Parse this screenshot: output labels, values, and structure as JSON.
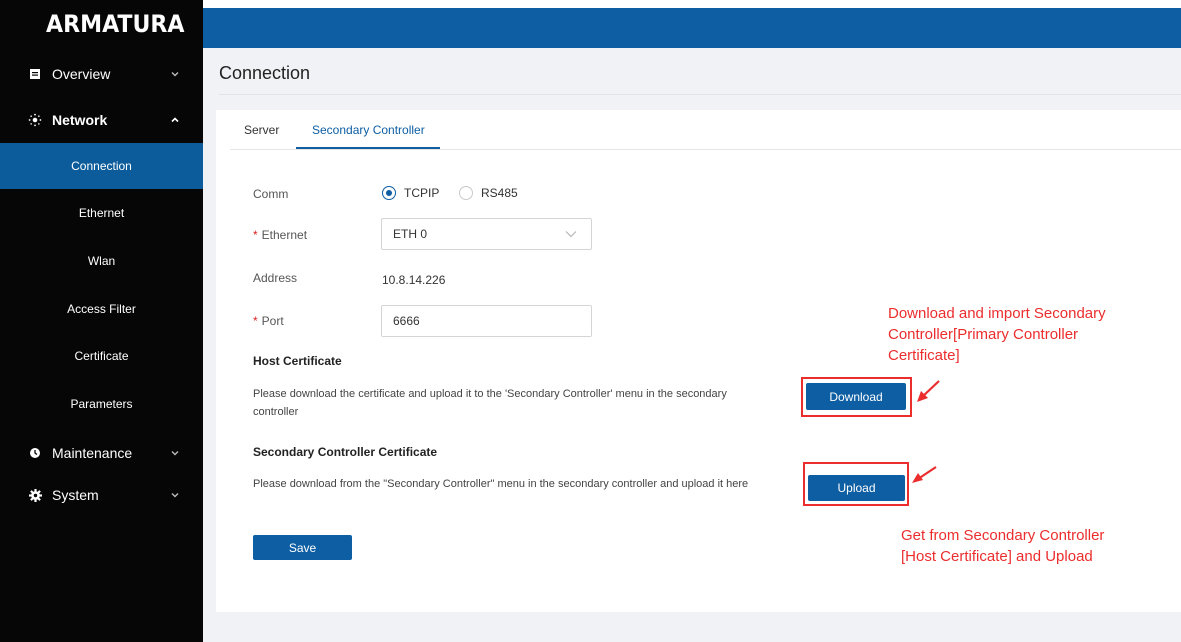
{
  "brand": {
    "logo_text": "ARMATURA"
  },
  "sidebar": {
    "groups": [
      {
        "label": "Overview",
        "icon": "overview-icon",
        "expanded": false
      },
      {
        "label": "Network",
        "icon": "network-icon",
        "expanded": true
      },
      {
        "label": "Maintenance",
        "icon": "maintenance-icon",
        "expanded": false
      },
      {
        "label": "System",
        "icon": "gear-icon",
        "expanded": false
      }
    ],
    "network_items": [
      {
        "label": "Connection",
        "active": true
      },
      {
        "label": "Ethernet",
        "active": false
      },
      {
        "label": "Wlan",
        "active": false
      },
      {
        "label": "Access Filter",
        "active": false
      },
      {
        "label": "Certificate",
        "active": false
      },
      {
        "label": "Parameters",
        "active": false
      }
    ]
  },
  "page": {
    "title": "Connection"
  },
  "tabs": [
    {
      "label": "Server",
      "active": false
    },
    {
      "label": "Secondary Controller",
      "active": true
    }
  ],
  "form": {
    "comm": {
      "label": "Comm",
      "options": [
        "TCPIP",
        "RS485"
      ],
      "selected": "TCPIP"
    },
    "ethernet": {
      "label": "Ethernet",
      "value": "ETH 0",
      "required": true
    },
    "address": {
      "label": "Address",
      "value": "10.8.14.226"
    },
    "port": {
      "label": "Port",
      "value": "6666",
      "required": true
    }
  },
  "host_certificate": {
    "heading": "Host Certificate",
    "desc_line1": "Please download the certificate and upload it to the 'Secondary Controller' menu in the secondary",
    "desc_line2": "controller",
    "button": "Download"
  },
  "secondary_certificate": {
    "heading": "Secondary Controller Certificate",
    "desc": "Please download from the \"Secondary Controller\" menu in the secondary controller and upload it here",
    "button": "Upload"
  },
  "save_button": "Save",
  "annotations": {
    "download_note": {
      "line1": "Download and import Secondary",
      "line2": "Controller[Primary Controller",
      "line3": "Certificate]"
    },
    "upload_note": {
      "line1": "Get from Secondary Controller",
      "line2": "[Host Certificate] and Upload"
    }
  },
  "colors": {
    "sidebar_bg": "#060606",
    "accent": "#0d5ea3",
    "active_nav": "#0c5c9c",
    "content_bg": "#f1f2f5",
    "annotation_red": "#ec2d2d",
    "required_star": "#e02020"
  }
}
